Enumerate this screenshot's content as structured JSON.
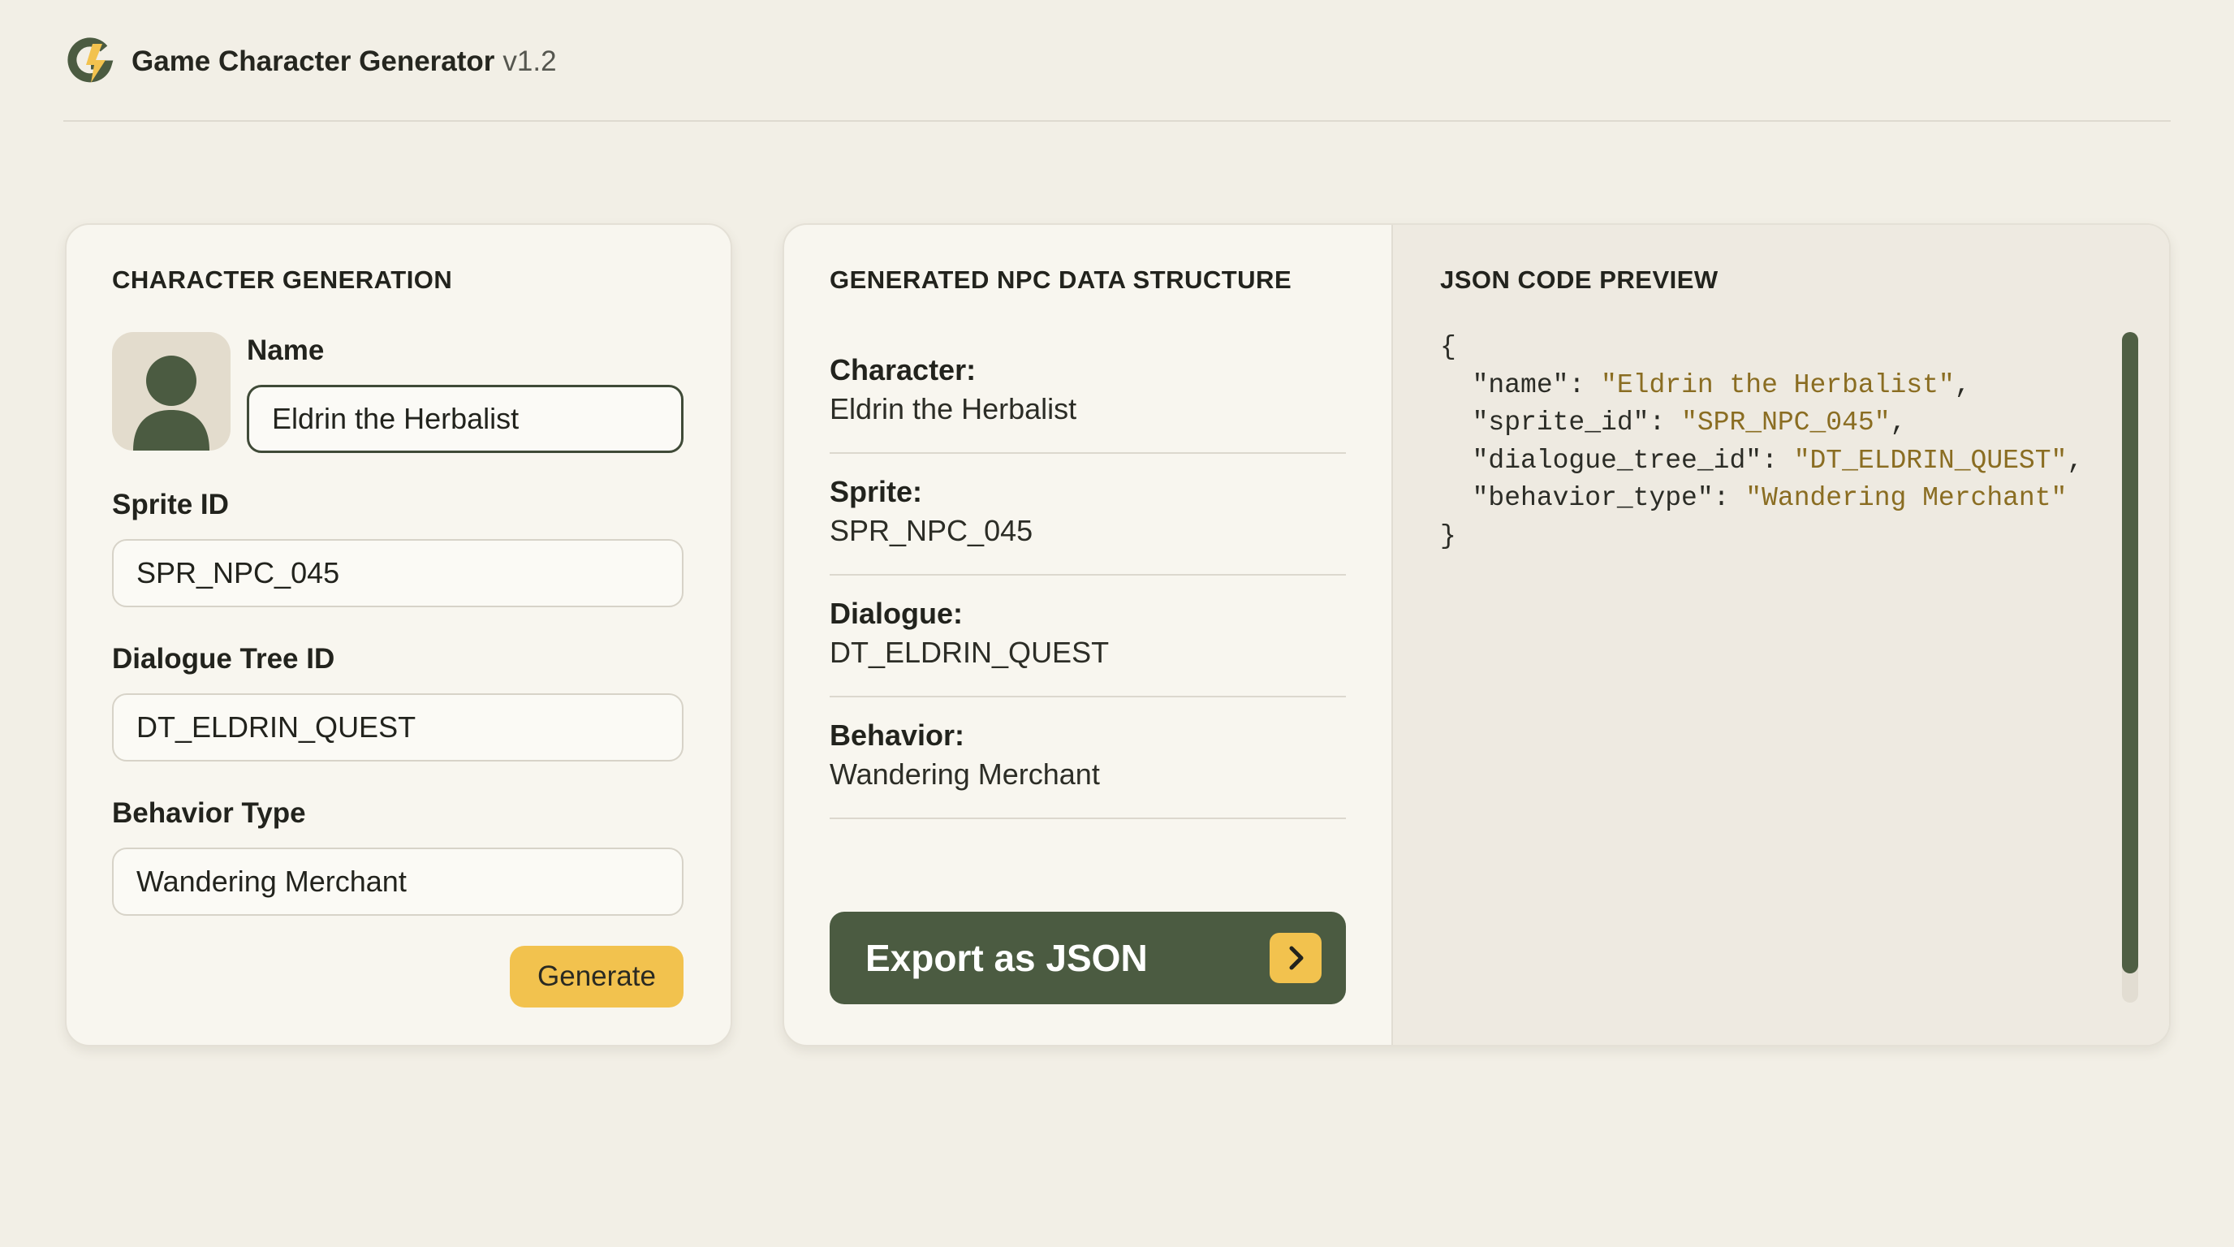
{
  "app": {
    "title": "Game Character Generator",
    "version": "v1.2",
    "logo_icon": "g-logo-icon"
  },
  "form": {
    "section_title": "CHARACTER GENERATION",
    "avatar_icon": "person-silhouette-icon",
    "name_label": "Name",
    "name_value": "Eldrin the Herbalist",
    "sprite_label": "Sprite ID",
    "sprite_value": "SPR_NPC_045",
    "dialogue_label": "Dialogue Tree ID",
    "dialogue_value": "DT_ELDRIN_QUEST",
    "behavior_label": "Behavior Type",
    "behavior_value": "Wandering Merchant",
    "generate_label": "Generate"
  },
  "npc": {
    "section_title": "GENERATED NPC DATA STRUCTURE",
    "items": [
      {
        "key": "Character:",
        "value": "Eldrin the Herbalist"
      },
      {
        "key": "Sprite:",
        "value": "SPR_NPC_045"
      },
      {
        "key": "Dialogue:",
        "value": "DT_ELDRIN_QUEST"
      },
      {
        "key": "Behavior:",
        "value": "Wandering Merchant"
      }
    ],
    "export_label": "Export as JSON",
    "export_icon": "chevron-right-icon"
  },
  "json_preview": {
    "section_title": "JSON CODE PREVIEW",
    "open_brace": "{",
    "close_brace": "}",
    "lines": [
      {
        "key": "\"name\"",
        "value": "\"Eldrin the Herbalist\"",
        "comma": ","
      },
      {
        "key": "\"sprite_id\"",
        "value": "\"SPR_NPC_045\"",
        "comma": ","
      },
      {
        "key": "\"dialogue_tree_id\"",
        "value": "\"DT_ELDRIN_QUEST\"",
        "comma": ","
      },
      {
        "key": "\"behavior_type\"",
        "value": "\"Wandering Merchant\"",
        "comma": ""
      }
    ]
  },
  "colors": {
    "background": "#f2efe6",
    "card": "#f8f6ef",
    "accent_green": "#4b5b41",
    "accent_yellow": "#f2c24e",
    "string_color": "#8a6d22"
  }
}
